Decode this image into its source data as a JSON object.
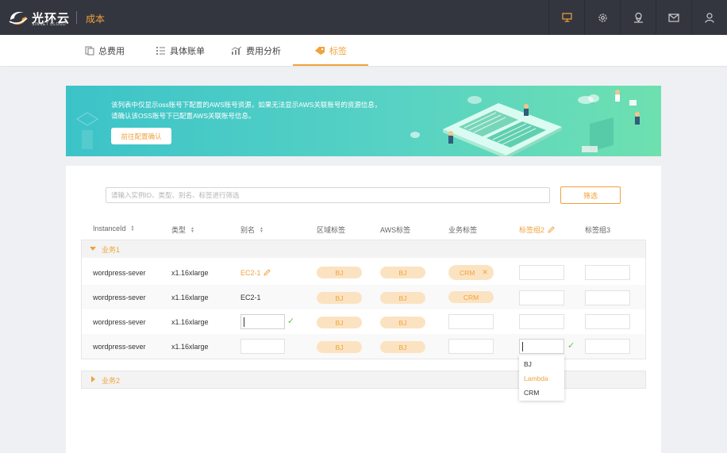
{
  "header": {
    "logo_text": "光环云",
    "logo_sub": "SINNET CLOUD",
    "title": "成本",
    "icons": [
      "monitor-icon",
      "settings-icon",
      "location-icon",
      "mail-icon",
      "user-icon"
    ],
    "accent_color": "#f0a23c",
    "bg_color": "#34363f"
  },
  "nav": {
    "tabs": [
      {
        "label": "总费用",
        "icon": "bill-icon",
        "active": false
      },
      {
        "label": "具体账单",
        "icon": "list-icon",
        "active": false
      },
      {
        "label": "费用分析",
        "icon": "chart-icon",
        "active": false
      },
      {
        "label": "标签",
        "icon": "tag-icon",
        "active": true
      }
    ]
  },
  "banner": {
    "line1": "该列表中仅显示oss账号下配置的AWS账号资源，如果无法显示AWS关联账号的资源信息，",
    "line2": "请确认该OSS账号下已配置AWS关联账号信息。",
    "button": "前往配置确认"
  },
  "search": {
    "placeholder": "请输入实例ID、类型、别名、标签进行筛选",
    "value": ""
  },
  "filter_button": "筛选",
  "columns": [
    "InstanceId",
    "类型",
    "别名",
    "区域标签",
    "AWS标签",
    "业务标签",
    "标签组2",
    "标签组3"
  ],
  "groups": [
    {
      "name": "业务1",
      "expanded": true,
      "rows": [
        {
          "instance": "wordpress-sever",
          "type": "x1.16xlarge",
          "alias": "EC2-1",
          "region": "BJ",
          "aws": "BJ",
          "biz": "CRM"
        },
        {
          "instance": "wordpress-sever",
          "type": "x1.16xlarge",
          "alias": "EC2-1",
          "region": "BJ",
          "aws": "BJ",
          "biz": "CRM"
        },
        {
          "instance": "wordpress-sever",
          "type": "x1.16xlarge",
          "alias": "",
          "region": "BJ",
          "aws": "BJ",
          "biz": ""
        },
        {
          "instance": "wordpress-sever",
          "type": "x1.16xlarge",
          "alias": "",
          "region": "BJ",
          "aws": "BJ",
          "biz": ""
        }
      ]
    },
    {
      "name": "业务2",
      "expanded": false
    }
  ],
  "dropdown": {
    "options": [
      "BJ",
      "Lambda",
      "CRM"
    ],
    "highlighted": "Lambda"
  }
}
